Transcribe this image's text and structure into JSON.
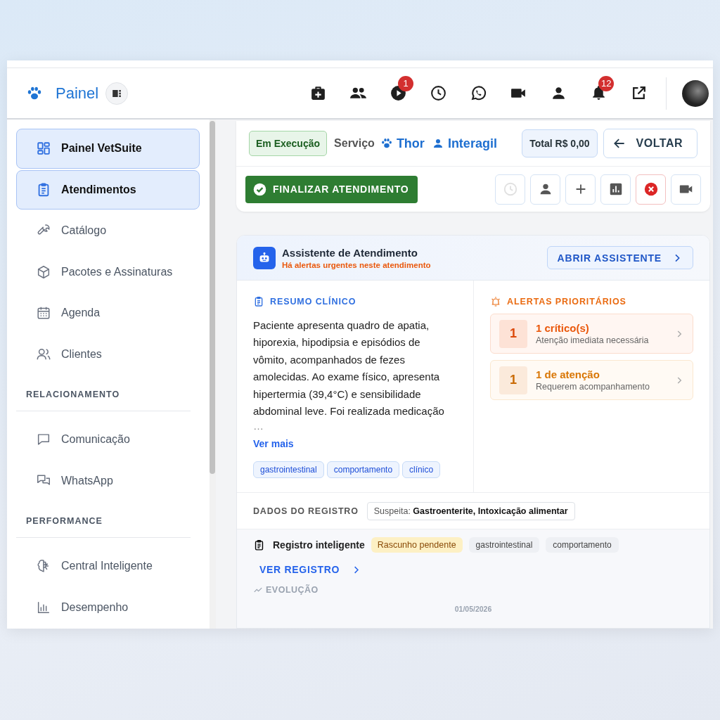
{
  "header": {
    "title": "Painel",
    "play_badge": "1",
    "bell_badge": "12"
  },
  "sidebar": {
    "items": [
      {
        "kind": "link",
        "label": "Painel VetSuite",
        "selected": true
      },
      {
        "kind": "link",
        "label": "Atendimentos",
        "selected": true
      },
      {
        "kind": "link",
        "label": "Catálogo",
        "selected": false
      },
      {
        "kind": "link",
        "label": "Pacotes e Assinaturas",
        "selected": false
      },
      {
        "kind": "link",
        "label": "Agenda",
        "selected": false
      },
      {
        "kind": "link",
        "label": "Clientes",
        "selected": false
      },
      {
        "kind": "section",
        "label": "RELACIONAMENTO"
      },
      {
        "kind": "link",
        "label": "Comunicação",
        "selected": false
      },
      {
        "kind": "link",
        "label": "WhatsApp",
        "selected": false
      },
      {
        "kind": "section",
        "label": "PERFORMANCE"
      },
      {
        "kind": "link",
        "label": "Central Inteligente",
        "selected": false
      },
      {
        "kind": "link",
        "label": "Desempenho",
        "selected": false
      }
    ]
  },
  "service_bar": {
    "status": "Em Execução",
    "service_label": "Serviço",
    "pet": "Thor",
    "client": "Interagil",
    "total": "Total R$ 0,00",
    "back_button": "VOLTAR",
    "finish_button": "FINALIZAR ATENDIMENTO",
    "actions": [
      {
        "disabled": true
      },
      {
        "disabled": false
      },
      {
        "disabled": false
      },
      {
        "disabled": false
      },
      {
        "disabled": false
      },
      {
        "disabled": false
      }
    ]
  },
  "assistant": {
    "title": "Assistente de Atendimento",
    "subtitle": "Há alertas urgentes neste atendimento",
    "open_button": "ABRIR ASSISTENTE",
    "summary": {
      "heading": "RESUMO CLÍNICO",
      "text": "Paciente apresenta quadro de apatia, hiporexia, hipodipsia e episódios de vômito, acompanhados de fezes amolecidas. Ao exame físico, apresenta hipertermia (39,4°C) e sensibilidade abdominal leve. Foi realizada medicação",
      "ellipsis": "…",
      "more_link": "Ver mais",
      "tags": [
        "gastrointestinal",
        "comportamento",
        "clínico"
      ]
    },
    "alerts": {
      "heading": "ALERTAS PRIORITÁRIOS",
      "items": [
        {
          "kind": "critical",
          "count": "1",
          "title": "1 crítico(s)",
          "subtitle": "Atenção imediata necessária"
        },
        {
          "kind": "attention",
          "count": "1",
          "title": "1 de atenção",
          "subtitle": "Requerem acompanhamento"
        }
      ]
    },
    "record": {
      "heading": "DADOS DO REGISTRO",
      "suspicion_label": "Suspeita:",
      "suspicion": "Gastroenterite, Intoxicação alimentar"
    },
    "smart_record": {
      "title": "Registro inteligente",
      "status": "Rascunho pendente",
      "tags": [
        "gastrointestinal",
        "comportamento"
      ],
      "link": "VER REGISTRO",
      "evolution_heading": "EVOLUÇÃO",
      "date": "01/05/2026"
    }
  }
}
